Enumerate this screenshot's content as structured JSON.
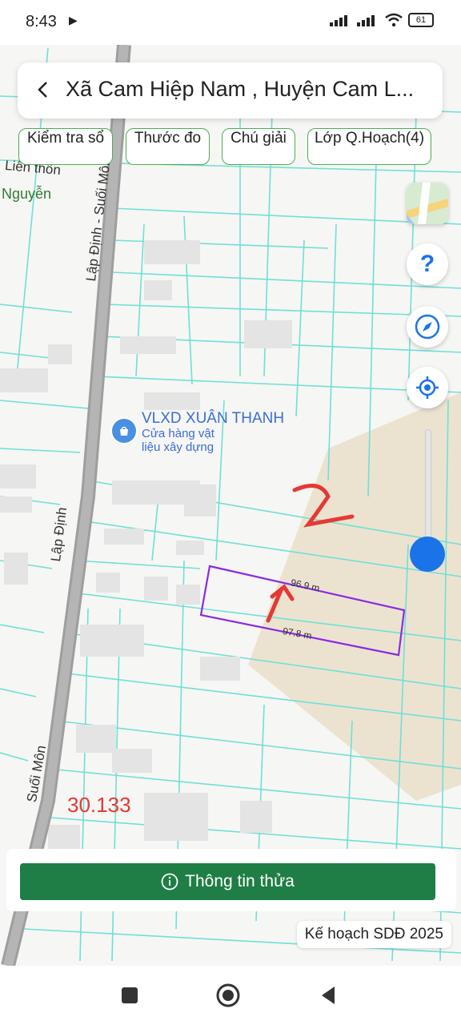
{
  "status_bar": {
    "time": "8:43",
    "play_icon": "play-icon",
    "battery": "61"
  },
  "header": {
    "title": "Xã Cam Hiệp Nam , Huyện Cam L..."
  },
  "chips": [
    {
      "label": "Kiểm tra sổ"
    },
    {
      "label": "Thước đo"
    },
    {
      "label": "Chú giải"
    },
    {
      "label": "Lớp Q.Hoạch(4)"
    }
  ],
  "map": {
    "streets": [
      "Lập Định - Suối Môn",
      "Suối Môn",
      "Lập Định",
      "Liên thôn"
    ],
    "area_label": "Nguyễn",
    "poi": {
      "name": "VLXD XUÂN THANH",
      "subtitle": "Cửa hàng vật liệu xây dựng"
    },
    "parcel": {
      "top_edge": "96.9 m",
      "bottom_edge": "97.8 m"
    },
    "annotation_number": "30.133",
    "handwritten": "2"
  },
  "controls": {
    "help": "?",
    "zoom_level": 0.15
  },
  "bottom": {
    "info_button": "Thông tin thửa",
    "plan_badge": "Kế hoạch SDĐ 2025"
  },
  "colors": {
    "accent_green": "#1e7e45",
    "parcel_lines": "#6fe0d6",
    "selected_parcel": "#8a2be2",
    "zone_fill": "#ebe3d0",
    "annotation_red": "#e53935"
  }
}
